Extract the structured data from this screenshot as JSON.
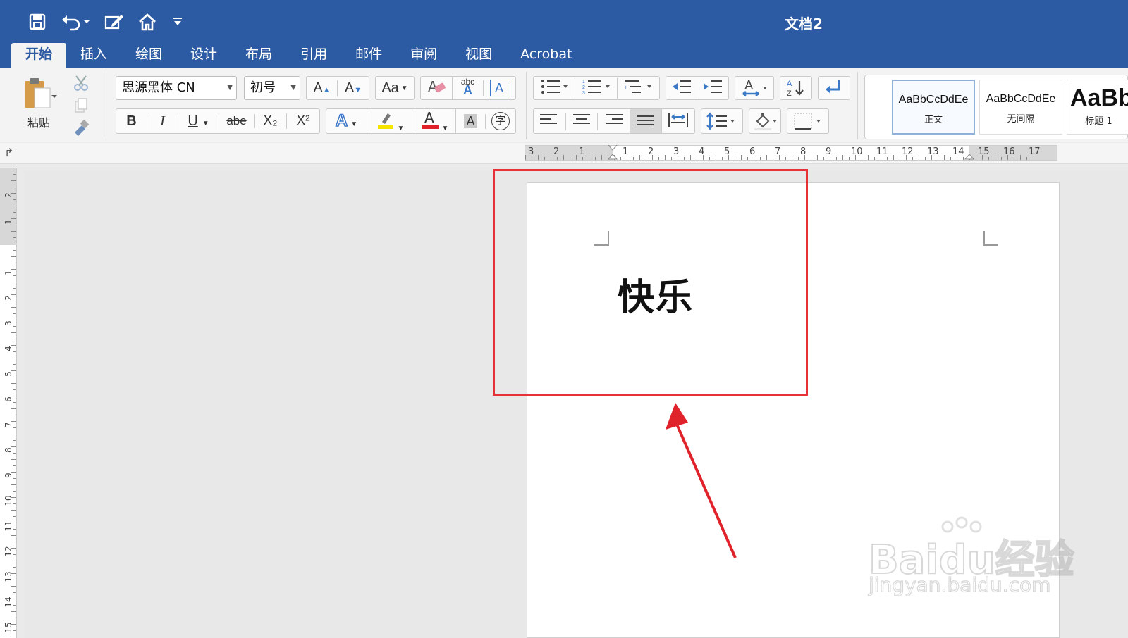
{
  "window": {
    "title": "文档2"
  },
  "quick_access": [
    "save-icon",
    "undo-icon",
    "edit-doc-icon",
    "home-icon",
    "customize-icon"
  ],
  "tabs": [
    {
      "label": "开始",
      "active": true
    },
    {
      "label": "插入"
    },
    {
      "label": "绘图"
    },
    {
      "label": "设计"
    },
    {
      "label": "布局"
    },
    {
      "label": "引用"
    },
    {
      "label": "邮件"
    },
    {
      "label": "审阅"
    },
    {
      "label": "视图"
    },
    {
      "label": "Acrobat"
    }
  ],
  "clipboard": {
    "paste_label": "粘贴"
  },
  "font": {
    "family": "思源黑体 CN",
    "size": "初号",
    "bold": "B",
    "italic": "I",
    "underline": "U",
    "strike": "abe",
    "subscript": "X₂",
    "superscript": "X²",
    "grow": "A",
    "shrink": "A",
    "case": "Aa",
    "clear_label": "abc"
  },
  "styles": [
    {
      "sample": "AaBbCcDdEe",
      "name": "正文",
      "selected": true
    },
    {
      "sample": "AaBbCcDdEe",
      "name": "无间隔"
    },
    {
      "sample": "AaBb",
      "name": "标题 1"
    }
  ],
  "ruler": {
    "h_numbers": [
      "3",
      "2",
      "1",
      "1",
      "2",
      "3",
      "4",
      "5",
      "6",
      "7",
      "8",
      "9",
      "10",
      "11",
      "12",
      "13",
      "14",
      "15",
      "16",
      "17"
    ],
    "v_numbers": [
      "2",
      "1",
      "1",
      "2",
      "3",
      "4",
      "5",
      "6",
      "7",
      "8",
      "9",
      "10",
      "11",
      "12",
      "13",
      "14",
      "15"
    ]
  },
  "document": {
    "text": "快乐"
  },
  "watermark": {
    "brand": "Baidu经验",
    "url": "jingyan.baidu.com"
  },
  "colors": {
    "accent": "#2c5ba3",
    "highlight_box": "#e53238",
    "arrow": "#e0222a",
    "font_color": "#e0202a",
    "highlight_color": "#f4e400"
  }
}
